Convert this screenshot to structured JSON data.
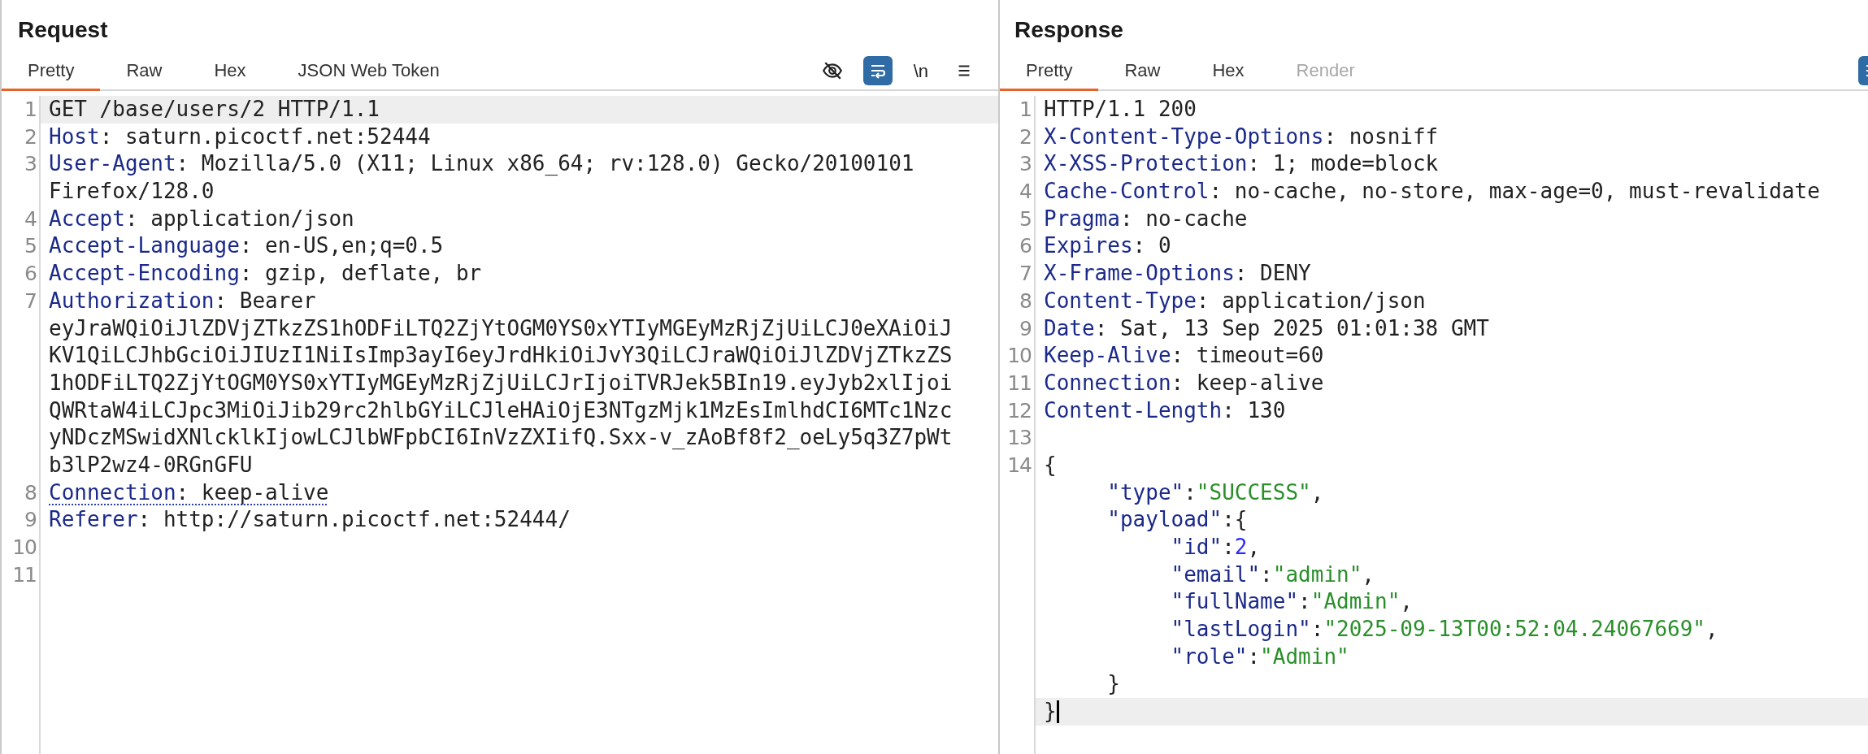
{
  "panes": [
    {
      "title": "Request",
      "tabs": [
        {
          "label": "Pretty",
          "selected": true,
          "disabled": false
        },
        {
          "label": "Raw",
          "selected": false,
          "disabled": false
        },
        {
          "label": "Hex",
          "selected": false,
          "disabled": false
        },
        {
          "label": "JSON Web Token",
          "selected": false,
          "disabled": false
        }
      ],
      "toolbar": [
        {
          "kind": "hide",
          "on": false
        },
        {
          "kind": "wrap",
          "on": true
        },
        {
          "kind": "newlines",
          "label": "\\n",
          "on": false
        },
        {
          "kind": "menu",
          "on": false
        }
      ],
      "lines": [
        {
          "number": "1",
          "underlined": false,
          "rows": [
            {
              "highlighted": true,
              "segments": [
                {
                  "kind": "plain",
                  "text": "GET /base/users/2 HTTP/1.1"
                }
              ]
            }
          ]
        },
        {
          "number": "2",
          "underlined": false,
          "rows": [
            {
              "highlighted": false,
              "segments": [
                {
                  "kind": "name",
                  "text": "Host"
                },
                {
                  "kind": "plain",
                  "text": ": saturn.picoctf.net:52444"
                }
              ]
            }
          ]
        },
        {
          "number": "3",
          "underlined": false,
          "rows": [
            {
              "highlighted": false,
              "segments": [
                {
                  "kind": "name",
                  "text": "User-Agent"
                },
                {
                  "kind": "plain",
                  "text": ": Mozilla/5.0 (X11; Linux x86_64; rv:128.0) Gecko/20100101"
                }
              ]
            },
            {
              "highlighted": false,
              "segments": [
                {
                  "kind": "plain",
                  "text": "Firefox/128.0"
                }
              ]
            }
          ]
        },
        {
          "number": "4",
          "underlined": false,
          "rows": [
            {
              "highlighted": false,
              "segments": [
                {
                  "kind": "name",
                  "text": "Accept"
                },
                {
                  "kind": "plain",
                  "text": ": application/json"
                }
              ]
            }
          ]
        },
        {
          "number": "5",
          "underlined": false,
          "rows": [
            {
              "highlighted": false,
              "segments": [
                {
                  "kind": "name",
                  "text": "Accept-Language"
                },
                {
                  "kind": "plain",
                  "text": ": en-US,en;q=0.5"
                }
              ]
            }
          ]
        },
        {
          "number": "6",
          "underlined": false,
          "rows": [
            {
              "highlighted": false,
              "segments": [
                {
                  "kind": "name",
                  "text": "Accept-Encoding"
                },
                {
                  "kind": "plain",
                  "text": ": gzip, deflate, br"
                }
              ]
            }
          ]
        },
        {
          "number": "7",
          "underlined": false,
          "rows": [
            {
              "highlighted": false,
              "segments": [
                {
                  "kind": "name",
                  "text": "Authorization"
                },
                {
                  "kind": "plain",
                  "text": ": Bearer"
                }
              ]
            },
            {
              "highlighted": false,
              "segments": [
                {
                  "kind": "plain",
                  "text": "eyJraWQiOiJlZDVjZTkzZS1hODFiLTQ2ZjYtOGM0YS0xYTIyMGEyMzRjZjUiLCJ0eXAiOiJ"
                }
              ]
            },
            {
              "highlighted": false,
              "segments": [
                {
                  "kind": "plain",
                  "text": "KV1QiLCJhbGciOiJIUzI1NiIsImp3ayI6eyJrdHkiOiJvY3QiLCJraWQiOiJlZDVjZTkzZS"
                }
              ]
            },
            {
              "highlighted": false,
              "segments": [
                {
                  "kind": "plain",
                  "text": "1hODFiLTQ2ZjYtOGM0YS0xYTIyMGEyMzRjZjUiLCJrIjoiTVRJek5BIn19.eyJyb2xlIjoi"
                }
              ]
            },
            {
              "highlighted": false,
              "segments": [
                {
                  "kind": "plain",
                  "text": "QWRtaW4iLCJpc3MiOiJib29rc2hlbGYiLCJleHAiOjE3NTgzMjk1MzEsImlhdCI6MTc1Nzc"
                }
              ]
            },
            {
              "highlighted": false,
              "segments": [
                {
                  "kind": "plain",
                  "text": "yNDczMSwidXNlcklkIjowLCJlbWFpbCI6InVzZXIifQ.Sxx-v_zAoBf8f2_oeLy5q3Z7pWt"
                }
              ]
            },
            {
              "highlighted": false,
              "segments": [
                {
                  "kind": "plain",
                  "text": "b3lP2wz4-0RGnGFU"
                }
              ]
            }
          ]
        },
        {
          "number": "8",
          "underlined": true,
          "rows": [
            {
              "highlighted": false,
              "segments": [
                {
                  "kind": "name",
                  "text": "Connection"
                },
                {
                  "kind": "plain",
                  "text": ": keep-alive"
                }
              ]
            }
          ]
        },
        {
          "number": "9",
          "underlined": false,
          "rows": [
            {
              "highlighted": false,
              "segments": [
                {
                  "kind": "name",
                  "text": "Referer"
                },
                {
                  "kind": "plain",
                  "text": ": http://saturn.picoctf.net:52444/"
                }
              ]
            }
          ]
        },
        {
          "number": "10",
          "rows": [
            {
              "highlighted": false
            }
          ]
        },
        {
          "number": "11",
          "rows": [
            {
              "highlighted": false
            }
          ]
        }
      ]
    },
    {
      "title": "Response",
      "tabs": [
        {
          "label": "Pretty",
          "selected": true,
          "disabled": false
        },
        {
          "label": "Raw",
          "selected": false,
          "disabled": false
        },
        {
          "label": "Hex",
          "selected": false,
          "disabled": false
        },
        {
          "label": "Render",
          "selected": false,
          "disabled": true
        }
      ],
      "toolbar": [
        {
          "kind": "wrap",
          "on": true
        }
      ],
      "lines": [
        {
          "number": "1",
          "underlined": false,
          "rows": [
            {
              "highlighted": false,
              "segments": [
                {
                  "kind": "plain",
                  "text": "HTTP/1.1 200"
                }
              ]
            }
          ]
        },
        {
          "number": "2",
          "underlined": false,
          "rows": [
            {
              "highlighted": false,
              "segments": [
                {
                  "kind": "name",
                  "text": "X-Content-Type-Options"
                },
                {
                  "kind": "plain",
                  "text": ": nosniff"
                }
              ]
            }
          ]
        },
        {
          "number": "3",
          "underlined": false,
          "rows": [
            {
              "highlighted": false,
              "segments": [
                {
                  "kind": "name",
                  "text": "X-XSS-Protection"
                },
                {
                  "kind": "plain",
                  "text": ": 1; mode=block"
                }
              ]
            }
          ]
        },
        {
          "number": "4",
          "underlined": false,
          "rows": [
            {
              "highlighted": false,
              "segments": [
                {
                  "kind": "name",
                  "text": "Cache-Control"
                },
                {
                  "kind": "plain",
                  "text": ": no-cache, no-store, max-age=0, must-revalidate"
                }
              ]
            }
          ]
        },
        {
          "number": "5",
          "underlined": false,
          "rows": [
            {
              "highlighted": false,
              "segments": [
                {
                  "kind": "name",
                  "text": "Pragma"
                },
                {
                  "kind": "plain",
                  "text": ": no-cache"
                }
              ]
            }
          ]
        },
        {
          "number": "6",
          "underlined": false,
          "rows": [
            {
              "highlighted": false,
              "segments": [
                {
                  "kind": "name",
                  "text": "Expires"
                },
                {
                  "kind": "plain",
                  "text": ": 0"
                }
              ]
            }
          ]
        },
        {
          "number": "7",
          "underlined": false,
          "rows": [
            {
              "highlighted": false,
              "segments": [
                {
                  "kind": "name",
                  "text": "X-Frame-Options"
                },
                {
                  "kind": "plain",
                  "text": ": DENY"
                }
              ]
            }
          ]
        },
        {
          "number": "8",
          "underlined": false,
          "rows": [
            {
              "highlighted": false,
              "segments": [
                {
                  "kind": "name",
                  "text": "Content-Type"
                },
                {
                  "kind": "plain",
                  "text": ": application/json"
                }
              ]
            }
          ]
        },
        {
          "number": "9",
          "underlined": false,
          "rows": [
            {
              "highlighted": false,
              "segments": [
                {
                  "kind": "name",
                  "text": "Date"
                },
                {
                  "kind": "plain",
                  "text": ": Sat, 13 Sep 2025 01:01:38 GMT"
                }
              ]
            }
          ]
        },
        {
          "number": "10",
          "underlined": false,
          "rows": [
            {
              "highlighted": false,
              "segments": [
                {
                  "kind": "name",
                  "text": "Keep-Alive"
                },
                {
                  "kind": "plain",
                  "text": ": timeout=60"
                }
              ]
            }
          ]
        },
        {
          "number": "11",
          "underlined": false,
          "rows": [
            {
              "highlighted": false,
              "segments": [
                {
                  "kind": "name",
                  "text": "Connection"
                },
                {
                  "kind": "plain",
                  "text": ": keep-alive"
                }
              ]
            }
          ]
        },
        {
          "number": "12",
          "underlined": false,
          "rows": [
            {
              "highlighted": false,
              "segments": [
                {
                  "kind": "name",
                  "text": "Content-Length"
                },
                {
                  "kind": "plain",
                  "text": ": 130"
                }
              ]
            }
          ]
        },
        {
          "number": "13",
          "rows": [
            {
              "highlighted": false
            }
          ]
        },
        {
          "number": "14",
          "underlined": false,
          "rows": [
            {
              "highlighted": false,
              "cursor": false,
              "segments": [
                {
                  "kind": "plain",
                  "text": "{"
                }
              ]
            },
            {
              "highlighted": false,
              "cursor": false,
              "segments": [
                {
                  "kind": "name",
                  "text": "     \"type\""
                },
                {
                  "kind": "plain",
                  "text": ":"
                },
                {
                  "kind": "string",
                  "text": "\"SUCCESS\""
                },
                {
                  "kind": "plain",
                  "text": ","
                }
              ]
            },
            {
              "highlighted": false,
              "cursor": false,
              "segments": [
                {
                  "kind": "name",
                  "text": "     \"payload\""
                },
                {
                  "kind": "plain",
                  "text": ":{"
                }
              ]
            },
            {
              "highlighted": false,
              "cursor": false,
              "segments": [
                {
                  "kind": "name",
                  "text": "          \"id\""
                },
                {
                  "kind": "plain",
                  "text": ":"
                },
                {
                  "kind": "number",
                  "text": "2"
                },
                {
                  "kind": "plain",
                  "text": ","
                }
              ]
            },
            {
              "highlighted": false,
              "cursor": false,
              "segments": [
                {
                  "kind": "name",
                  "text": "          \"email\""
                },
                {
                  "kind": "plain",
                  "text": ":"
                },
                {
                  "kind": "string",
                  "text": "\"admin\""
                },
                {
                  "kind": "plain",
                  "text": ","
                }
              ]
            },
            {
              "highlighted": false,
              "cursor": false,
              "segments": [
                {
                  "kind": "name",
                  "text": "          \"fullName\""
                },
                {
                  "kind": "plain",
                  "text": ":"
                },
                {
                  "kind": "string",
                  "text": "\"Admin\""
                },
                {
                  "kind": "plain",
                  "text": ","
                }
              ]
            },
            {
              "highlighted": false,
              "cursor": false,
              "segments": [
                {
                  "kind": "name",
                  "text": "          \"lastLogin\""
                },
                {
                  "kind": "plain",
                  "text": ":"
                },
                {
                  "kind": "string",
                  "text": "\"2025-09-13T00:52:04.24067669\""
                },
                {
                  "kind": "plain",
                  "text": ","
                }
              ]
            },
            {
              "highlighted": false,
              "cursor": false,
              "segments": [
                {
                  "kind": "name",
                  "text": "          \"role\""
                },
                {
                  "kind": "plain",
                  "text": ":"
                },
                {
                  "kind": "string",
                  "text": "\"Admin\""
                }
              ]
            },
            {
              "highlighted": false,
              "cursor": false,
              "segments": [
                {
                  "kind": "plain",
                  "text": "     }"
                }
              ]
            },
            {
              "highlighted": true,
              "cursor": true,
              "segments": [
                {
                  "kind": "plain",
                  "text": "}"
                }
              ]
            }
          ]
        }
      ]
    }
  ]
}
